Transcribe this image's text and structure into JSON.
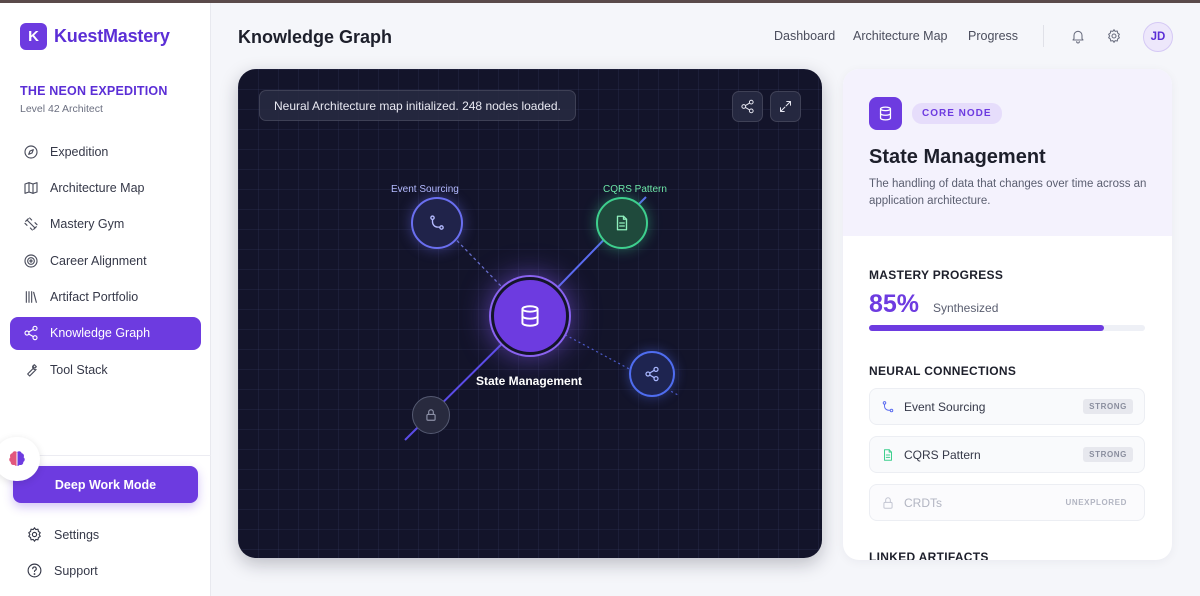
{
  "app": {
    "logo_letter": "K",
    "name": "KuestMastery"
  },
  "expedition": {
    "title": "THE NEON EXPEDITION",
    "subtitle": "Level 42 Architect"
  },
  "sidebar": {
    "items": [
      {
        "label": "Expedition",
        "icon": "compass-icon"
      },
      {
        "label": "Architecture Map",
        "icon": "map-icon"
      },
      {
        "label": "Mastery Gym",
        "icon": "dumbbell-icon"
      },
      {
        "label": "Career Alignment",
        "icon": "target-icon"
      },
      {
        "label": "Artifact Portfolio",
        "icon": "library-icon"
      },
      {
        "label": "Knowledge Graph",
        "icon": "share-icon",
        "active": true
      },
      {
        "label": "Tool Stack",
        "icon": "wrench-icon"
      }
    ],
    "deep_work_label": "Deep Work Mode",
    "settings_label": "Settings",
    "support_label": "Support"
  },
  "header": {
    "title": "Knowledge Graph",
    "nav": [
      "Dashboard",
      "Architecture Map",
      "Progress"
    ],
    "avatar_initials": "JD"
  },
  "graph": {
    "toast": "Neural Architecture map initialized. 248 nodes loaded.",
    "center_label": "State Management",
    "nodes": {
      "event_sourcing": "Event Sourcing",
      "cqrs": "CQRS Pattern"
    }
  },
  "panel": {
    "badge": "CORE NODE",
    "title": "State Management",
    "description": "The handling of data that changes over time across an application architecture.",
    "mastery_title": "MASTERY PROGRESS",
    "mastery_pct": "85%",
    "mastery_fraction": 0.85,
    "mastery_sub": "Synthesized",
    "connections_title": "NEURAL CONNECTIONS",
    "connections": [
      {
        "label": "Event Sourcing",
        "tag": "STRONG",
        "icon": "git-merge-icon"
      },
      {
        "label": "CQRS Pattern",
        "tag": "STRONG",
        "icon": "document-icon"
      },
      {
        "label": "CRDTs",
        "tag": "UNEXPLORED",
        "icon": "lock-icon"
      }
    ],
    "linked_title": "LINKED ARTIFACTS"
  },
  "colors": {
    "accent": "#6d3be0",
    "graph_bg": "#13142a",
    "green": "#3ecf8e",
    "blue": "#5b7cf0"
  }
}
